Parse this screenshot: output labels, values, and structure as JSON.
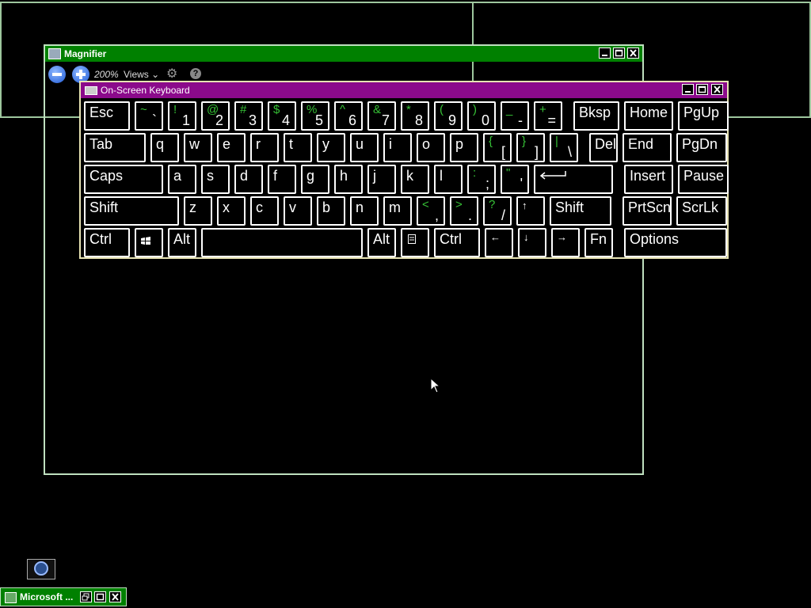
{
  "magnifier": {
    "title": "Magnifier",
    "zoom": "200%",
    "views_label": "Views",
    "title_color": "#008000"
  },
  "osk": {
    "title": "On-Screen Keyboard",
    "title_color": "#8b0a8b",
    "rows": [
      [
        {
          "name": "key-esc",
          "label": "Esc"
        },
        {
          "name": "key-tilde",
          "shift": "~",
          "primary": "`"
        },
        {
          "name": "key-1",
          "shift": "!",
          "primary": "1"
        },
        {
          "name": "key-2",
          "shift": "@",
          "primary": "2"
        },
        {
          "name": "key-3",
          "shift": "#",
          "primary": "3"
        },
        {
          "name": "key-4",
          "shift": "$",
          "primary": "4"
        },
        {
          "name": "key-5",
          "shift": "%",
          "primary": "5"
        },
        {
          "name": "key-6",
          "shift": "^",
          "primary": "6"
        },
        {
          "name": "key-7",
          "shift": "&",
          "primary": "7"
        },
        {
          "name": "key-8",
          "shift": "*",
          "primary": "8"
        },
        {
          "name": "key-9",
          "shift": "(",
          "primary": "9"
        },
        {
          "name": "key-0",
          "shift": ")",
          "primary": "0"
        },
        {
          "name": "key-minus",
          "shift": "_",
          "primary": "-"
        },
        {
          "name": "key-equals",
          "shift": "+",
          "primary": "="
        },
        {
          "name": "key-backspace",
          "label": "Bksp"
        },
        {
          "name": "key-home",
          "label": "Home"
        },
        {
          "name": "key-pgup",
          "label": "PgUp"
        }
      ],
      [
        {
          "name": "key-tab",
          "label": "Tab"
        },
        {
          "name": "key-q",
          "label": "q"
        },
        {
          "name": "key-w",
          "label": "w"
        },
        {
          "name": "key-e",
          "label": "e"
        },
        {
          "name": "key-r",
          "label": "r"
        },
        {
          "name": "key-t",
          "label": "t"
        },
        {
          "name": "key-y",
          "label": "y"
        },
        {
          "name": "key-u",
          "label": "u"
        },
        {
          "name": "key-i",
          "label": "i"
        },
        {
          "name": "key-o",
          "label": "o"
        },
        {
          "name": "key-p",
          "label": "p"
        },
        {
          "name": "key-lbracket",
          "shift": "{",
          "primary": "["
        },
        {
          "name": "key-rbracket",
          "shift": "}",
          "primary": "]"
        },
        {
          "name": "key-backslash",
          "shift": "|",
          "primary": "\\"
        },
        {
          "name": "key-del",
          "label": "Del"
        },
        {
          "name": "key-end",
          "label": "End"
        },
        {
          "name": "key-pgdn",
          "label": "PgDn"
        }
      ],
      [
        {
          "name": "key-caps",
          "label": "Caps"
        },
        {
          "name": "key-a",
          "label": "a"
        },
        {
          "name": "key-s",
          "label": "s"
        },
        {
          "name": "key-d",
          "label": "d"
        },
        {
          "name": "key-f",
          "label": "f"
        },
        {
          "name": "key-g",
          "label": "g"
        },
        {
          "name": "key-h",
          "label": "h"
        },
        {
          "name": "key-j",
          "label": "j"
        },
        {
          "name": "key-k",
          "label": "k"
        },
        {
          "name": "key-l",
          "label": "l"
        },
        {
          "name": "key-semicolon",
          "shift": ":",
          "primary": ";"
        },
        {
          "name": "key-quote",
          "shift": "\"",
          "primary": "'"
        },
        {
          "name": "key-enter",
          "icon": "enter-arrow-icon"
        },
        {
          "name": "key-insert",
          "label": "Insert"
        },
        {
          "name": "key-pause",
          "label": "Pause"
        }
      ],
      [
        {
          "name": "key-shift-left",
          "label": "Shift"
        },
        {
          "name": "key-z",
          "label": "z"
        },
        {
          "name": "key-x",
          "label": "x"
        },
        {
          "name": "key-c",
          "label": "c"
        },
        {
          "name": "key-v",
          "label": "v"
        },
        {
          "name": "key-b",
          "label": "b"
        },
        {
          "name": "key-n",
          "label": "n"
        },
        {
          "name": "key-m",
          "label": "m"
        },
        {
          "name": "key-comma",
          "shift": "<",
          "primary": ","
        },
        {
          "name": "key-period",
          "shift": ">",
          "primary": "."
        },
        {
          "name": "key-slash",
          "shift": "?",
          "primary": "/"
        },
        {
          "name": "key-up",
          "label": "↑"
        },
        {
          "name": "key-shift-right",
          "label": "Shift"
        },
        {
          "name": "key-prtscn",
          "label": "PrtScn"
        },
        {
          "name": "key-scrlk",
          "label": "ScrLk"
        }
      ],
      [
        {
          "name": "key-ctrl-left",
          "label": "Ctrl"
        },
        {
          "name": "key-windows",
          "icon": "windows-logo-icon"
        },
        {
          "name": "key-alt-left",
          "label": "Alt"
        },
        {
          "name": "key-space",
          "label": ""
        },
        {
          "name": "key-alt-right",
          "label": "Alt"
        },
        {
          "name": "key-menu",
          "icon": "menu-icon"
        },
        {
          "name": "key-ctrl-right",
          "label": "Ctrl"
        },
        {
          "name": "key-left",
          "label": "←"
        },
        {
          "name": "key-down",
          "label": "↓"
        },
        {
          "name": "key-right",
          "label": "→"
        },
        {
          "name": "key-fn",
          "label": "Fn"
        },
        {
          "name": "key-options",
          "label": "Options"
        }
      ]
    ]
  },
  "taskbar": {
    "window_title": "Microsoft ..."
  }
}
